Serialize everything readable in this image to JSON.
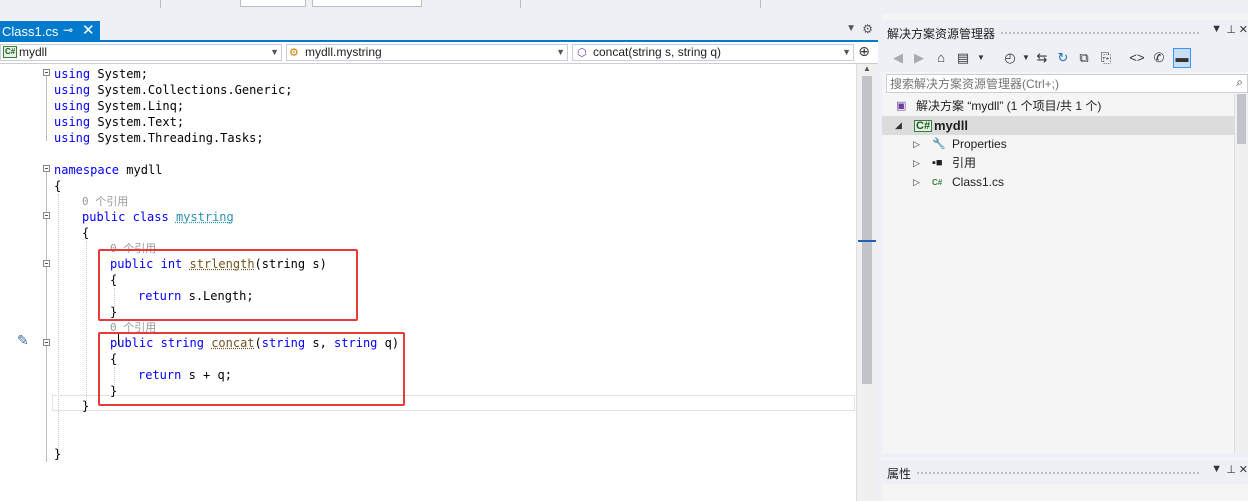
{
  "editor": {
    "tab": {
      "label": "Class1.cs",
      "pin_glyph": "⊸",
      "close_glyph": "✕"
    },
    "nav": {
      "project": "mydll",
      "class": "mydll.mystring",
      "member": "concat(string s, string q)"
    },
    "code": {
      "usings": [
        "System",
        "System.Collections.Generic",
        "System.Linq",
        "System.Text",
        "System.Threading.Tasks"
      ],
      "using_kw": "using",
      "namespace_kw": "namespace",
      "namespace_name": "mydll",
      "codelens_refs": "0 个引用",
      "public_kw": "public",
      "class_kw": "class",
      "class_name": "mystring",
      "int_kw": "int",
      "string_kw": "string",
      "return_kw": "return",
      "method1_name": "strlength",
      "method1_params": "(string s)",
      "method1_body": "s.Length;",
      "method2_name": "concat",
      "method2_params_a": "(",
      "method2_params_b": " s, ",
      "method2_params_c": " q)",
      "method2_body": "s + q;",
      "open_brace": "{",
      "close_brace": "}"
    },
    "colors": {
      "keyword": "#0000ff",
      "type": "#2b91af",
      "comment": "#999999",
      "accent": "#007acc",
      "highlight": "#e53b3b"
    }
  },
  "solution_explorer": {
    "title": "解决方案资源管理器",
    "search_placeholder": "搜索解决方案资源管理器(Ctrl+;)",
    "tree": {
      "solution": "解决方案 “mydll” (1 个项目/共 1 个)",
      "project": "mydll",
      "properties": "Properties",
      "references": "引用",
      "file": "Class1.cs"
    },
    "toolbar_icons": [
      "back-icon",
      "forward-icon",
      "home-icon",
      "switch-views-icon",
      "pending-changes-icon",
      "sync-icon",
      "refresh-icon",
      "collapse-all-icon",
      "show-all-files-icon",
      "view-code-icon",
      "properties-icon",
      "preview-icon"
    ]
  },
  "properties": {
    "title": "属性"
  }
}
